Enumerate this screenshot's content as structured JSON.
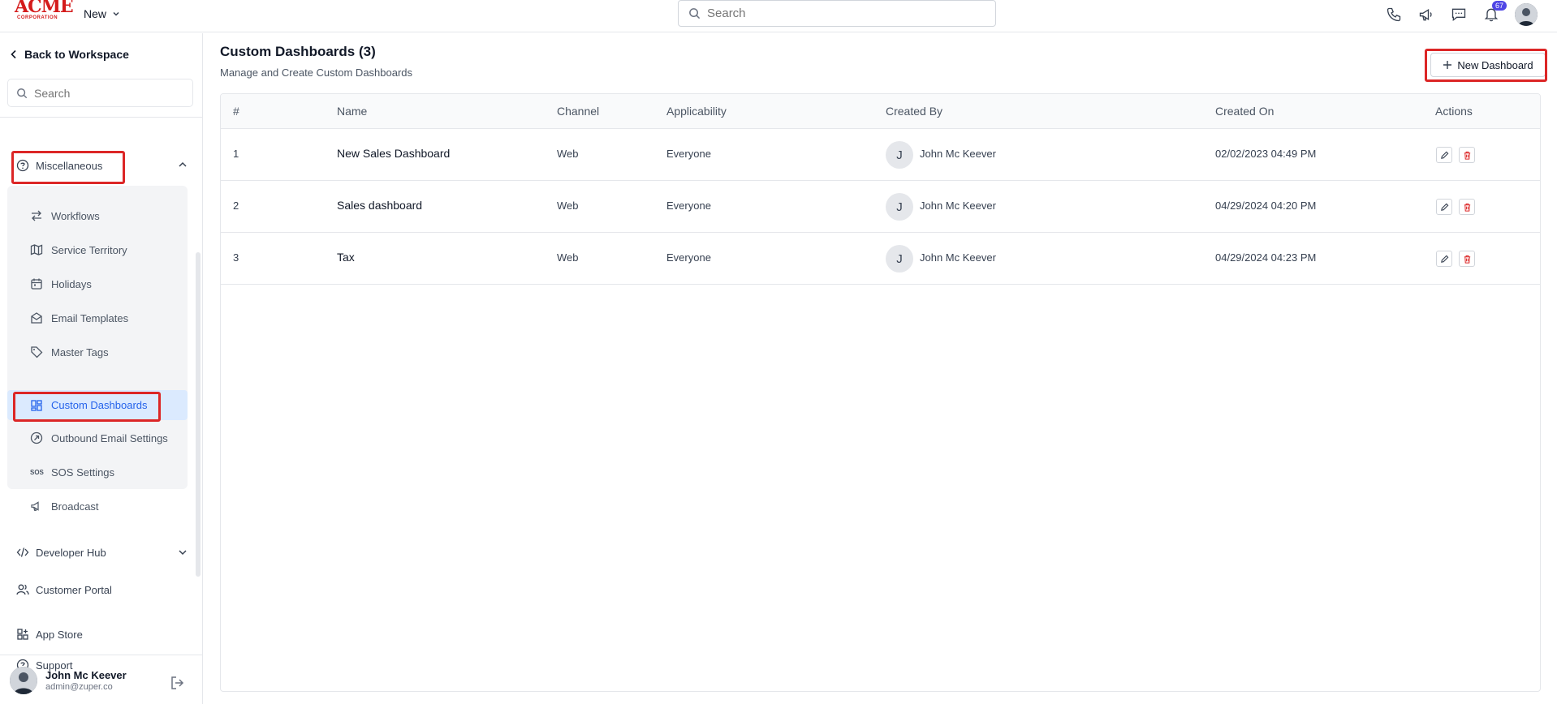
{
  "header": {
    "logo_text": "ACME",
    "logo_subtext": "CORPORATION",
    "new_label": "New",
    "search_placeholder": "Search",
    "notification_count": "67"
  },
  "sidebar": {
    "back_label": "Back to Workspace",
    "search_placeholder": "Search",
    "section_label": "Miscellaneous",
    "submenu": [
      {
        "label": "Workflows",
        "icon": "arrows-icon"
      },
      {
        "label": "Service Territory",
        "icon": "map-icon"
      },
      {
        "label": "Holidays",
        "icon": "calendar-icon"
      },
      {
        "label": "Email Templates",
        "icon": "envelope-icon"
      },
      {
        "label": "Master Tags",
        "icon": "tag-icon"
      },
      {
        "label": "Custom Dashboards",
        "icon": "dashboard-icon",
        "active": true
      },
      {
        "label": "Outbound Email Settings",
        "icon": "outbound-icon"
      },
      {
        "label": "SOS Settings",
        "icon": "sos-icon"
      },
      {
        "label": "Broadcast",
        "icon": "megaphone-icon"
      }
    ],
    "sos_glyph": "SOS",
    "developer_hub": "Developer Hub",
    "customer_portal": "Customer Portal",
    "app_store": "App Store",
    "support": "Support",
    "user": {
      "name": "John Mc Keever",
      "email": "admin@zuper.co"
    }
  },
  "main": {
    "title": "Custom Dashboards (3)",
    "subtitle": "Manage and Create Custom Dashboards",
    "new_button": "New Dashboard",
    "columns": [
      "#",
      "Name",
      "Channel",
      "Applicability",
      "Created By",
      "Created On",
      "Actions"
    ],
    "rows": [
      {
        "num": "1",
        "name": "New Sales Dashboard",
        "channel": "Web",
        "applicability": "Everyone",
        "initial": "J",
        "created_by": "John Mc Keever",
        "created_on": "02/02/2023 04:49 PM"
      },
      {
        "num": "2",
        "name": "Sales dashboard",
        "channel": "Web",
        "applicability": "Everyone",
        "initial": "J",
        "created_by": "John Mc Keever",
        "created_on": "04/29/2024 04:20 PM"
      },
      {
        "num": "3",
        "name": "Tax",
        "channel": "Web",
        "applicability": "Everyone",
        "initial": "J",
        "created_by": "John Mc Keever",
        "created_on": "04/29/2024 04:23 PM"
      }
    ]
  },
  "colors": {
    "accent": "#2563eb",
    "highlight": "#dc2626",
    "delete": "#dc2626"
  }
}
